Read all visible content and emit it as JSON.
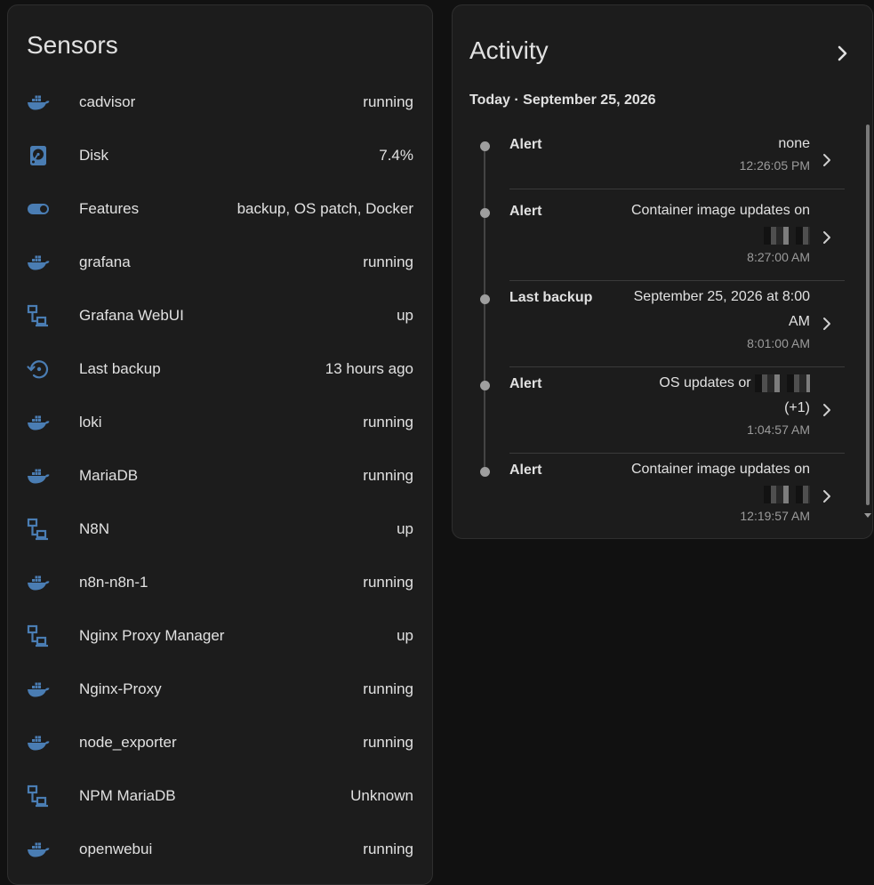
{
  "sensors": {
    "title": "Sensors",
    "items": [
      {
        "icon": "docker-icon",
        "name": "cadvisor",
        "value": "running"
      },
      {
        "icon": "harddisk-icon",
        "name": "Disk",
        "value": "7.4%"
      },
      {
        "icon": "toggle-icon",
        "name": "Features",
        "value": "backup, OS patch, Docker"
      },
      {
        "icon": "docker-icon",
        "name": "grafana",
        "value": "running"
      },
      {
        "icon": "lan-icon",
        "name": "Grafana WebUI",
        "value": "up"
      },
      {
        "icon": "backup-restore-icon",
        "name": "Last backup",
        "value": "13 hours ago"
      },
      {
        "icon": "docker-icon",
        "name": "loki",
        "value": "running"
      },
      {
        "icon": "docker-icon",
        "name": "MariaDB",
        "value": "running"
      },
      {
        "icon": "lan-icon",
        "name": "N8N",
        "value": "up"
      },
      {
        "icon": "docker-icon",
        "name": "n8n-n8n-1",
        "value": "running"
      },
      {
        "icon": "lan-icon",
        "name": "Nginx Proxy Manager",
        "value": "up"
      },
      {
        "icon": "docker-icon",
        "name": "Nginx-Proxy",
        "value": "running"
      },
      {
        "icon": "docker-icon",
        "name": "node_exporter",
        "value": "running"
      },
      {
        "icon": "lan-icon",
        "name": "NPM MariaDB",
        "value": "Unknown"
      },
      {
        "icon": "docker-icon",
        "name": "openwebui",
        "value": "running"
      }
    ]
  },
  "activity": {
    "title": "Activity",
    "date_header": "Today · September 25, 2026",
    "entries": [
      {
        "label": "Alert",
        "message": "none",
        "time": "12:26:05 PM"
      },
      {
        "label": "Alert",
        "message": "Container image updates on",
        "time": "8:27:00 AM"
      },
      {
        "label": "Last backup",
        "message": "September 25, 2026 at 8:00 AM",
        "time": "8:01:00 AM"
      },
      {
        "label": "Alert",
        "message": "OS updates or",
        "message_suffix": "(+1)",
        "time": "1:04:57 AM"
      },
      {
        "label": "Alert",
        "message": "Container image updates on",
        "time": "12:19:57 AM"
      }
    ]
  },
  "colors": {
    "background": "#111111",
    "card": "#1c1c1c",
    "icon": "#4a7db3",
    "text": "#e1e1e1",
    "secondary_text": "#9b9b9b"
  }
}
